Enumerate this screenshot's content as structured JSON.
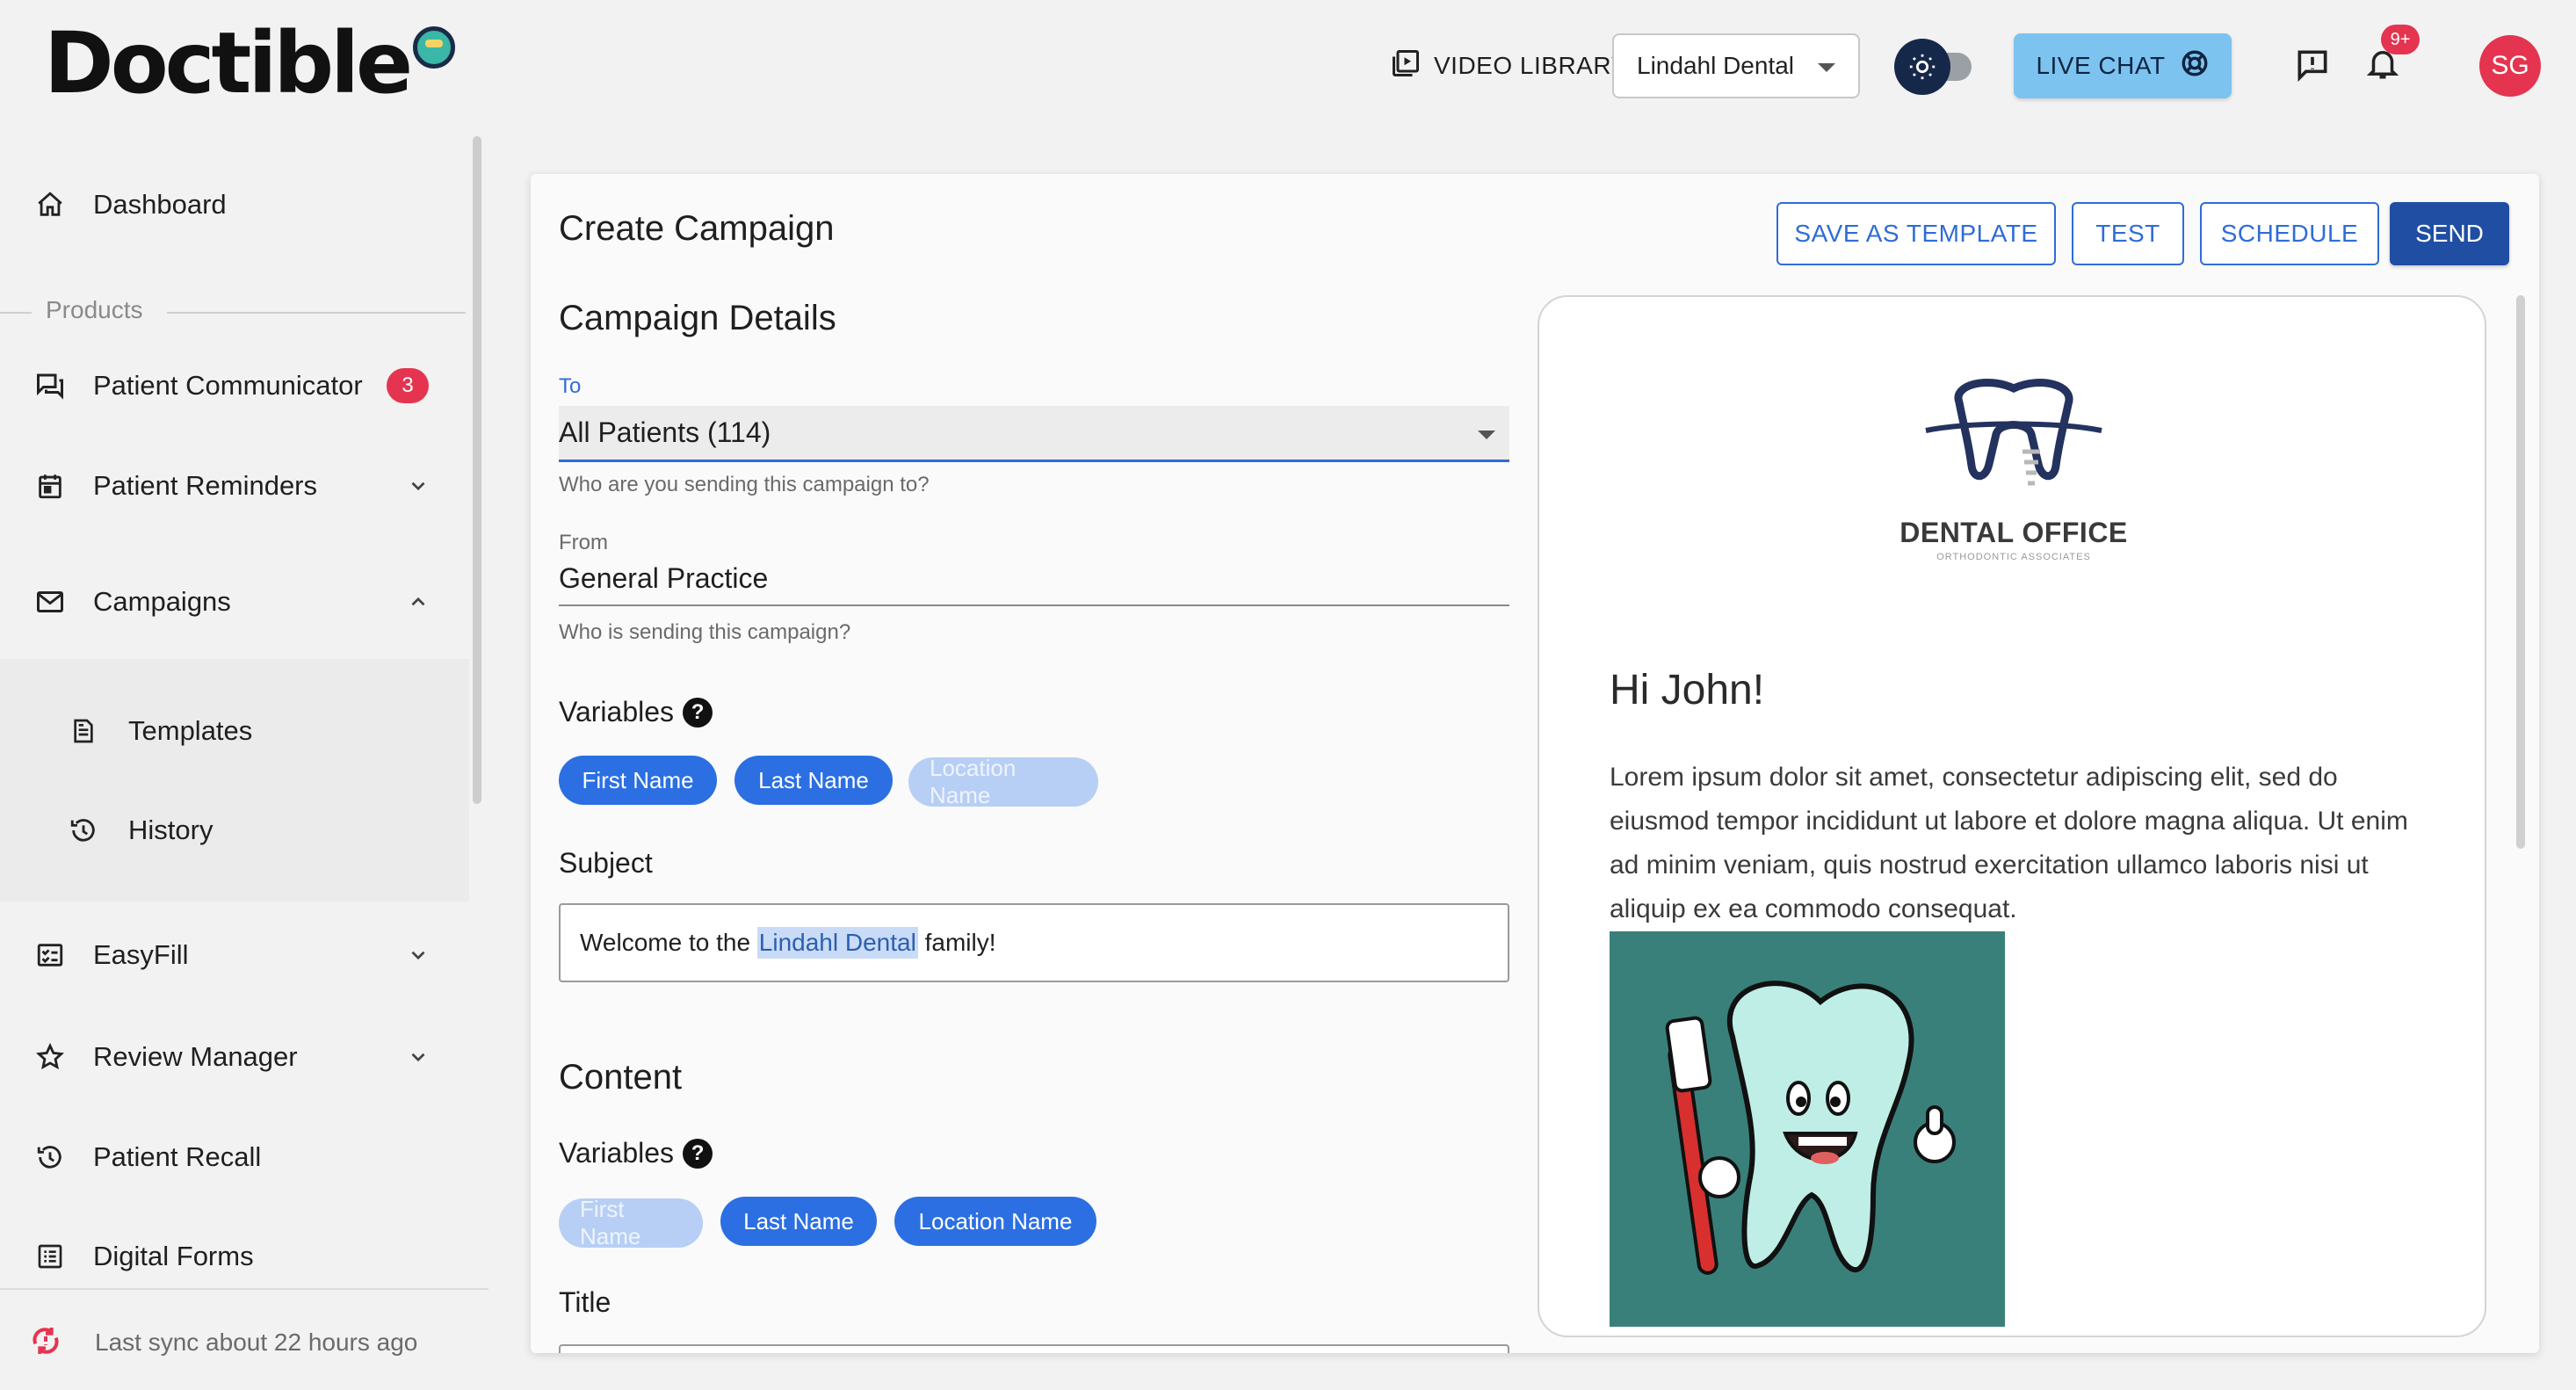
{
  "app": {
    "logo_text": "Doctible"
  },
  "header": {
    "video_library_label": "VIDEO LIBRARY",
    "location_select": "Lindahl Dental",
    "live_chat_label": "LIVE CHAT",
    "notifications_badge": "9+",
    "avatar_initials": "SG"
  },
  "sidebar": {
    "dashboard": "Dashboard",
    "products_divider": "Products",
    "patient_communicator": "Patient Communicator",
    "patient_communicator_badge": "3",
    "patient_reminders": "Patient Reminders",
    "campaigns": "Campaigns",
    "templates": "Templates",
    "history": "History",
    "easyfill": "EasyFill",
    "review_manager": "Review Manager",
    "patient_recall": "Patient Recall",
    "digital_forms": "Digital Forms",
    "sync_status": "Last sync about 22 hours ago"
  },
  "page": {
    "title": "Create Campaign",
    "save_template_label": "SAVE AS TEMPLATE",
    "test_label": "TEST",
    "schedule_label": "SCHEDULE",
    "send_label": "SEND"
  },
  "details": {
    "heading": "Campaign Details",
    "to_label": "To",
    "to_value": "All Patients (114)",
    "to_help": "Who are you sending this campaign to?",
    "from_label": "From",
    "from_value": "General Practice",
    "from_help": "Who is sending this campaign?",
    "variables_label": "Variables",
    "variables": [
      "First Name",
      "Last Name",
      "Location Name"
    ],
    "subject_label": "Subject",
    "subject_prefix": "Welcome to the ",
    "subject_highlight": "Lindahl Dental",
    "subject_suffix": " family!"
  },
  "content": {
    "heading": "Content",
    "variables_label": "Variables",
    "variables": [
      "First Name",
      "Last Name",
      "Location Name"
    ],
    "title_label": "Title"
  },
  "preview": {
    "logo_name": "DENTAL OFFICE",
    "logo_sub": "ORTHODONTIC ASSOCIATES",
    "greeting": "Hi John!",
    "body": "Lorem ipsum dolor sit amet, consectetur adipiscing elit, sed do eiusmod tempor incididunt ut labore et dolore magna aliqua. Ut enim ad minim veniam, quis nostrud exercitation ullamco laboris nisi ut aliquip ex ea commodo consequat."
  },
  "colors": {
    "primary": "#2f6cd8",
    "send_button": "#1f4ea3",
    "badge": "#e53450",
    "live_chat": "#7cc3f0",
    "chip_active": "#2b6fe2",
    "chip_disabled": "#b7cff5",
    "image_bg": "#3a807a"
  }
}
